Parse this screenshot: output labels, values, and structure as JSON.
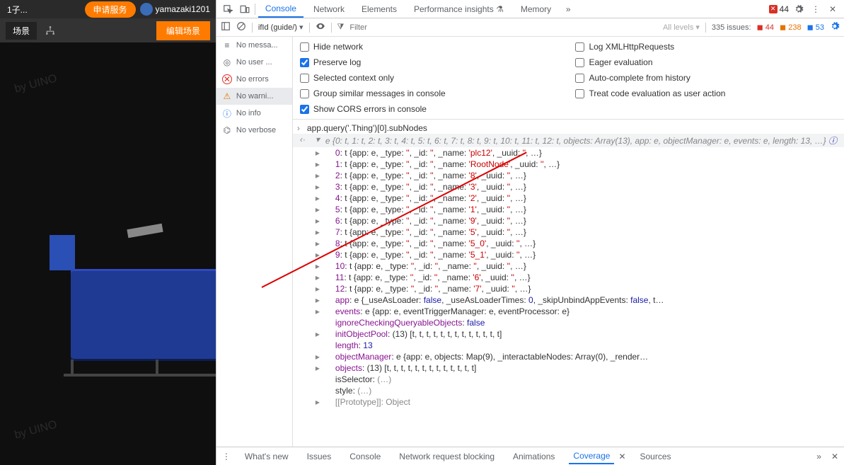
{
  "left": {
    "tab_suffix": "1子...",
    "apply_service": "申请服务",
    "username": "yamazaki1201",
    "scene_tab": "场景",
    "edit_scene": "编辑场景",
    "watermark": "by UINO",
    "watermark2": "by UINO"
  },
  "devtools": {
    "tabs": {
      "console": "Console",
      "network": "Network",
      "elements": "Elements",
      "performance": "Performance insights",
      "memory": "Memory"
    },
    "error_count": "44",
    "filterbar": {
      "context": "ifId (guide/)",
      "filter_placeholder": "Filter",
      "levels": "All levels",
      "issues_label": "335 issues:",
      "issue_err": "44",
      "issue_warn": "238",
      "issue_info": "53"
    },
    "sidebar": {
      "nomsg": "No messa...",
      "nouser": "No user ...",
      "noerrors": "No errors",
      "nowarn": "No warni...",
      "noinfo": "No info",
      "noverbose": "No verbose"
    },
    "settings": {
      "hide_network": "Hide network",
      "log_xhr": "Log XMLHttpRequests",
      "preserve_log": "Preserve log",
      "eager_eval": "Eager evaluation",
      "selected_ctx": "Selected context only",
      "autocomplete": "Auto-complete from history",
      "group_similar": "Group similar messages in console",
      "treat_eval": "Treat code evaluation as user action",
      "show_cors": "Show CORS errors in console"
    },
    "console": {
      "prompt": "app.query('.Thing')[0].subNodes",
      "header_line": "e {0: t, 1: t, 2: t, 3: t, 4: t, 5: t, 6: t, 7: t, 8: t, 9: t, 10: t, 11: t, 12: t, objects: Array(13), app: e, objectManager: e, events: e, length: 13, …}",
      "items": [
        {
          "idx": "0",
          "name": "'plc12'"
        },
        {
          "idx": "1",
          "name": "'RootNode'"
        },
        {
          "idx": "2",
          "name": "'8'"
        },
        {
          "idx": "3",
          "name": "'3'"
        },
        {
          "idx": "4",
          "name": "'2'"
        },
        {
          "idx": "5",
          "name": "'1'"
        },
        {
          "idx": "6",
          "name": "'9'"
        },
        {
          "idx": "7",
          "name": "'5'"
        },
        {
          "idx": "8",
          "name": "'5_0'"
        },
        {
          "idx": "9",
          "name": "'5_1'"
        },
        {
          "idx": "10",
          "name": "''"
        },
        {
          "idx": "11",
          "name": "'6'"
        },
        {
          "idx": "12",
          "name": "'7'"
        }
      ],
      "app_line": "app: e {_useAsLoader: false, _useAsLoaderTimes: 0, _skipUnbindAppEvents: false, t…",
      "events_line": "events: e {app: e, eventTriggerManager: e, eventProcessor: e}",
      "ignore_line": "ignoreCheckingQueryableObjects: false",
      "init_line": "initObjectPool: (13) [t, t, t, t, t, t, t, t, t, t, t, t, t]",
      "length_line": "length: 13",
      "objmgr_line": "objectManager: e {app: e, objects: Map(9), _interactableNodes: Array(0), _render…",
      "objects_line": "objects: (13) [t, t, t, t, t, t, t, t, t, t, t, t, t]",
      "isselector": "isSelector: (…)",
      "style": "style: (…)",
      "proto": "[[Prototype]]: Object"
    },
    "drawer": {
      "tabs": [
        "What's new",
        "Issues",
        "Console",
        "Network request blocking",
        "Animations",
        "Coverage",
        "Sources"
      ]
    }
  }
}
